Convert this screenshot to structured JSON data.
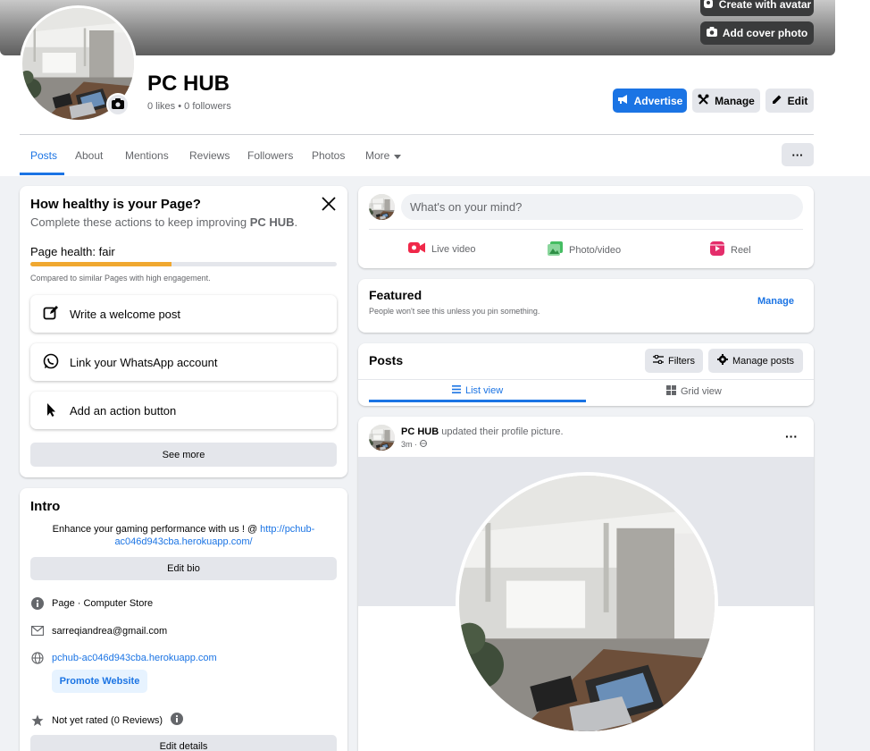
{
  "cover": {
    "create_avatar_label": "Create with avatar",
    "add_cover_label": "Add cover photo"
  },
  "profile": {
    "name": "PC HUB",
    "stats": "0 likes • 0 followers"
  },
  "actions": {
    "advertise": "Advertise",
    "manage": "Manage",
    "edit": "Edit"
  },
  "tabs": [
    {
      "label": "Posts"
    },
    {
      "label": "About"
    },
    {
      "label": "Mentions"
    },
    {
      "label": "Reviews"
    },
    {
      "label": "Followers"
    },
    {
      "label": "Photos"
    },
    {
      "label": "More"
    }
  ],
  "more_dots": "···",
  "page_health": {
    "title": "How healthy is your Page?",
    "subtitle_prefix": "Complete these actions to keep improving ",
    "subtitle_page": "PC HUB",
    "subtitle_suffix": ".",
    "health_label": "Page health: fair",
    "health_level": 0.46,
    "compare_note": "Compared to similar Pages with high engagement.",
    "items": [
      {
        "label": "Write a welcome post",
        "icon": "compose-icon"
      },
      {
        "label": "Link your WhatsApp account",
        "icon": "whatsapp-icon"
      },
      {
        "label": "Add an action button",
        "icon": "cursor-icon"
      }
    ],
    "see_more": "See more"
  },
  "intro": {
    "title": "Intro",
    "bio_text": "Enhance your gaming performance with us ! @ ",
    "bio_link_line1": "http://pchub-",
    "bio_link_line2": "ac046d943cba.herokuapp.com/",
    "edit_bio": "Edit bio",
    "category": "Page · Computer Store",
    "email": "sarreqiandrea@gmail.com",
    "website": "pchub-ac046d943cba.herokuapp.com",
    "promote": "Promote Website",
    "rating": "Not yet rated (0 Reviews)",
    "edit_details": "Edit details"
  },
  "composer": {
    "placeholder": "What's on your mind?",
    "live": "Live video",
    "photo": "Photo/video",
    "reel": "Reel"
  },
  "featured": {
    "title": "Featured",
    "subtitle": "People won't see this unless you pin something.",
    "manage": "Manage"
  },
  "posts_section": {
    "title": "Posts",
    "filters": "Filters",
    "manage_posts": "Manage posts",
    "list_view": "List view",
    "grid_view": "Grid view"
  },
  "post": {
    "author": "PC HUB",
    "action": " updated their profile picture.",
    "time": "3m ·",
    "dots": "···"
  },
  "colors": {
    "accent": "#1b74e4",
    "health_bar": "#f0a830",
    "background": "#f0f2f5"
  }
}
